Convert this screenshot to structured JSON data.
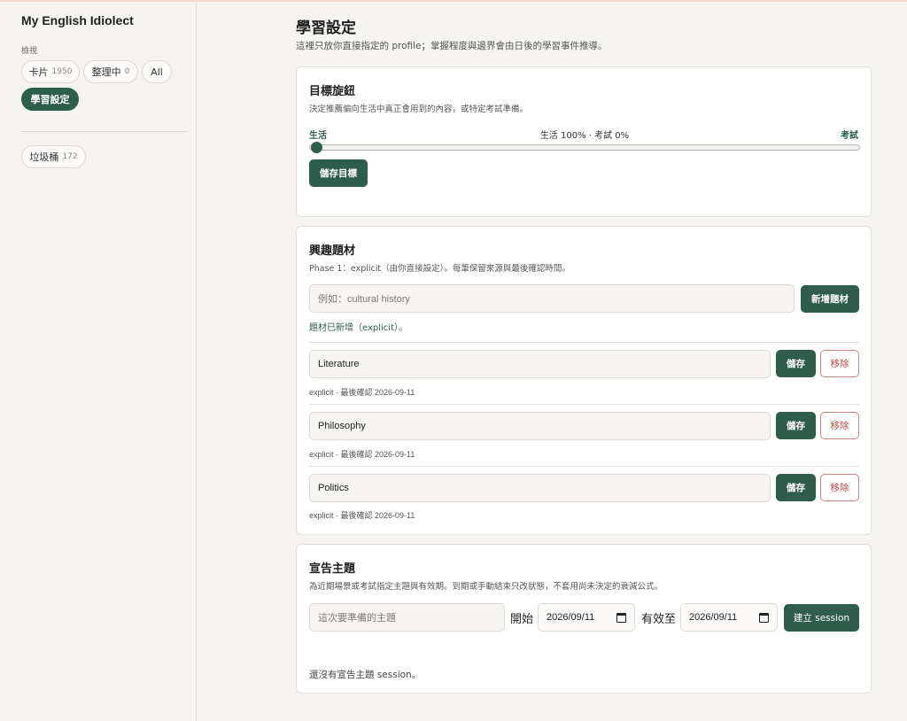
{
  "sidebar": {
    "app_title": "My English Idiolect",
    "view_label": "檢視",
    "chips": [
      {
        "label": "卡片",
        "count": "1950"
      },
      {
        "label": "整理中",
        "count": "0"
      },
      {
        "label": "All",
        "count": ""
      },
      {
        "label": "學習設定",
        "count": ""
      }
    ],
    "trash": {
      "label": "垃圾桶",
      "count": "172"
    }
  },
  "page": {
    "title": "學習設定",
    "subtitle": "這裡只放你直接指定的 profile；掌握程度與邊界會由日後的學習事件推導。"
  },
  "goal": {
    "title": "目標旋鈕",
    "subtitle": "決定推薦偏向生活中真正會用到的內容，或特定考試準備。",
    "left_label": "生活",
    "center_label": "生活 100% · 考試 0%",
    "right_label": "考試",
    "exam_fraction": 0.0,
    "save_label": "儲存目標"
  },
  "interests": {
    "title": "興趣題材",
    "subtitle": "Phase 1：explicit（由你直接設定）。每筆保留來源與最後確認時間。",
    "new_placeholder": "例如：cultural history",
    "add_label": "新增題材",
    "status": "題材已新增（explicit）。",
    "save_label": "儲存",
    "remove_label": "移除",
    "items": [
      {
        "value": "Literature",
        "meta": "explicit · 最後確認 2026-09-11"
      },
      {
        "value": "Philosophy",
        "meta": "explicit · 最後確認 2026-09-11"
      },
      {
        "value": "Politics",
        "meta": "explicit · 最後確認 2026-09-11"
      }
    ]
  },
  "declared": {
    "title": "宣告主題",
    "subtitle": "為近期場景或考試指定主題與有效期。到期或手動結束只改狀態，不套用尚未決定的衰減公式。",
    "topic_placeholder": "這次要準備的主題",
    "start_label": "開始",
    "start_date": "2026/09/11",
    "until_label": "有效至",
    "end_date": "2026/09/11",
    "create_label": "建立 session",
    "empty_text": "還沒有宣告主題 session。"
  },
  "colors": {
    "accent": "#2f5d4c",
    "danger": "#b14a44"
  }
}
